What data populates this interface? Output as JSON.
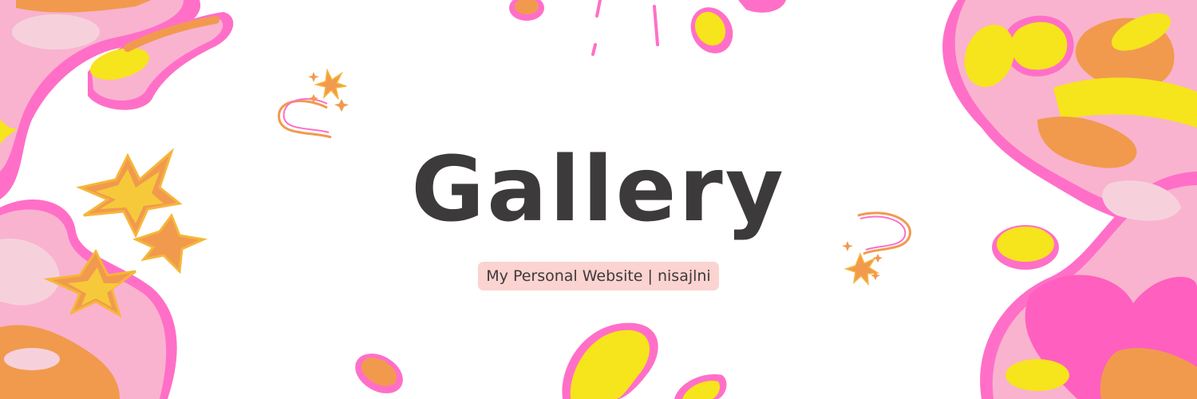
{
  "banner": {
    "title": "Gallery",
    "subtitle": "My Personal Website | nisajlni"
  },
  "colors": {
    "background": "#ffffff",
    "title_text": "#3d3a3b",
    "subtitle_pill": "#fbd3d0",
    "pink": "#ff6fc8",
    "light_pink": "#f9b3cf",
    "yellow": "#f6e41c",
    "orange": "#f19a4e"
  },
  "decorations": [
    "blob-left",
    "blob-right",
    "star-cluster",
    "sparkle-top",
    "sparkle-right",
    "burst-lines",
    "jelly-beans"
  ]
}
